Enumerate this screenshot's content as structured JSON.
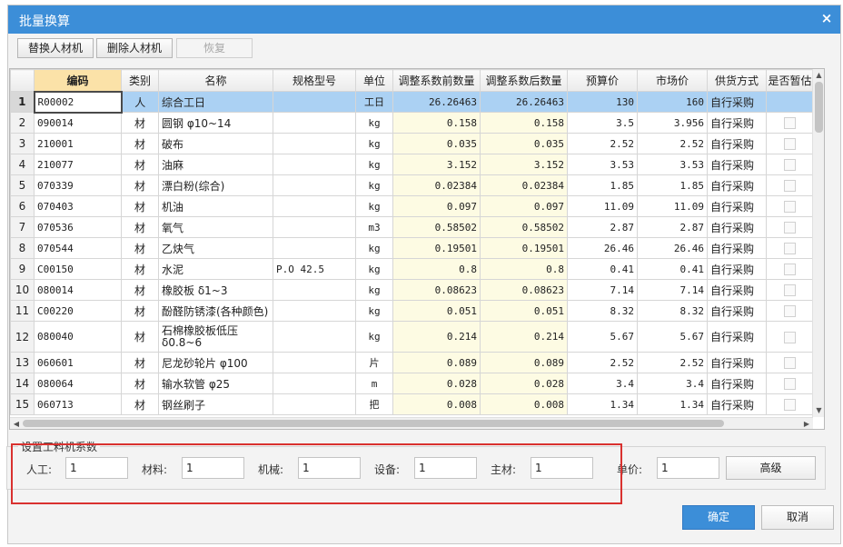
{
  "dialog": {
    "title": "批量换算",
    "close_icon": "×"
  },
  "toolbar": {
    "replace": "替换人材机",
    "delete": "删除人材机",
    "restore": "恢复"
  },
  "table": {
    "headers": [
      "",
      "编码",
      "类别",
      "名称",
      "规格型号",
      "单位",
      "调整系数前数量",
      "调整系数后数量",
      "预算价",
      "市场价",
      "供货方式",
      "是否暂估"
    ],
    "rows": [
      [
        "1",
        "R00002",
        "人",
        "综合工日",
        "",
        "工日",
        "26.26463",
        "26.26463",
        "130",
        "160",
        "自行采购"
      ],
      [
        "2",
        "090014",
        "材",
        "圆钢 φ10~14",
        "",
        "kg",
        "0.158",
        "0.158",
        "3.5",
        "3.956",
        "自行采购"
      ],
      [
        "3",
        "210001",
        "材",
        "破布",
        "",
        "kg",
        "0.035",
        "0.035",
        "2.52",
        "2.52",
        "自行采购"
      ],
      [
        "4",
        "210077",
        "材",
        "油麻",
        "",
        "kg",
        "3.152",
        "3.152",
        "3.53",
        "3.53",
        "自行采购"
      ],
      [
        "5",
        "070339",
        "材",
        "漂白粉(综合)",
        "",
        "kg",
        "0.02384",
        "0.02384",
        "1.85",
        "1.85",
        "自行采购"
      ],
      [
        "6",
        "070403",
        "材",
        "机油",
        "",
        "kg",
        "0.097",
        "0.097",
        "11.09",
        "11.09",
        "自行采购"
      ],
      [
        "7",
        "070536",
        "材",
        "氧气",
        "",
        "m3",
        "0.58502",
        "0.58502",
        "2.87",
        "2.87",
        "自行采购"
      ],
      [
        "8",
        "070544",
        "材",
        "乙炔气",
        "",
        "kg",
        "0.19501",
        "0.19501",
        "26.46",
        "26.46",
        "自行采购"
      ],
      [
        "9",
        "C00150",
        "材",
        "水泥",
        "P.O 42.5",
        "kg",
        "0.8",
        "0.8",
        "0.41",
        "0.41",
        "自行采购"
      ],
      [
        "10",
        "080014",
        "材",
        "橡胶板 δ1~3",
        "",
        "kg",
        "0.08623",
        "0.08623",
        "7.14",
        "7.14",
        "自行采购"
      ],
      [
        "11",
        "C00220",
        "材",
        "酚醛防锈漆(各种颜色)",
        "",
        "kg",
        "0.051",
        "0.051",
        "8.32",
        "8.32",
        "自行采购"
      ],
      [
        "12",
        "080040",
        "材",
        "石棉橡胶板低压 δ0.8~6",
        "",
        "kg",
        "0.214",
        "0.214",
        "5.67",
        "5.67",
        "自行采购"
      ],
      [
        "13",
        "060601",
        "材",
        "尼龙砂轮片 φ100",
        "",
        "片",
        "0.089",
        "0.089",
        "2.52",
        "2.52",
        "自行采购"
      ],
      [
        "14",
        "080064",
        "材",
        "输水软管 φ25",
        "",
        "m",
        "0.028",
        "0.028",
        "3.4",
        "3.4",
        "自行采购"
      ],
      [
        "15",
        "060713",
        "材",
        "钢丝刷子",
        "",
        "把",
        "0.008",
        "0.008",
        "1.34",
        "1.34",
        "自行采购"
      ]
    ]
  },
  "coefficients": {
    "title": "设置工料机系数",
    "labor_label": "人工:",
    "labor_value": "1",
    "material_label": "材料:",
    "material_value": "1",
    "machine_label": "机械:",
    "machine_value": "1",
    "equipment_label": "设备:",
    "equipment_value": "1",
    "main_material_label": "主材:",
    "main_material_value": "1",
    "unit_price_label": "单价:",
    "unit_price_value": "1",
    "advanced": "高级"
  },
  "footer": {
    "ok": "确定",
    "cancel": "取消"
  },
  "colors": {
    "title_bar": "#3c8ed8",
    "selected_row": "#abd1f3",
    "highlight_box": "#d9312f",
    "sorted_header": "#fbe2a8",
    "qty_cell": "#fdfbe3"
  }
}
